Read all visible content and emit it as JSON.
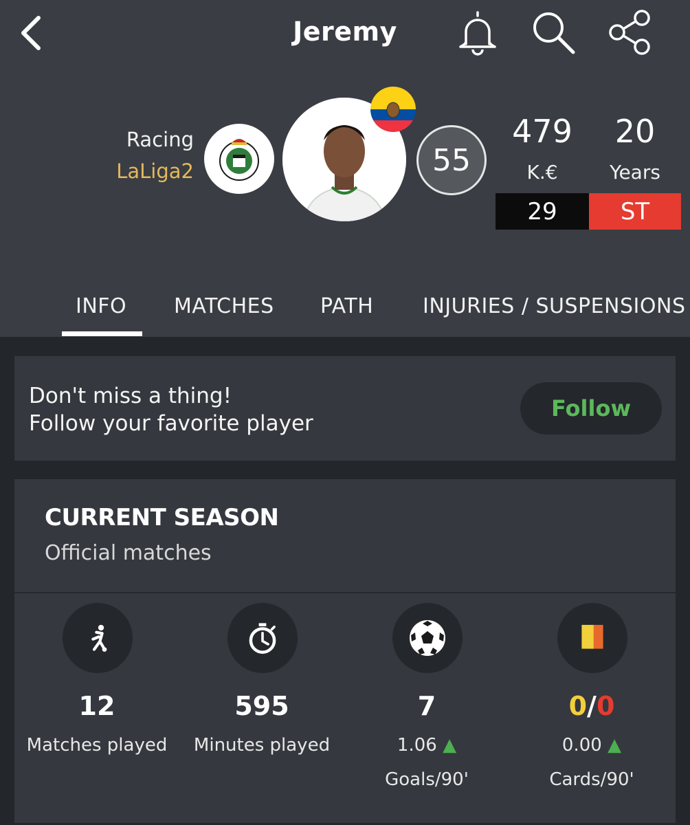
{
  "header": {
    "title": "Jeremy",
    "team": "Racing",
    "league": "LaLiga2",
    "rating": "55",
    "value": "479",
    "value_unit": "K.€",
    "age": "20",
    "age_unit": "Years",
    "shirt_number": "29",
    "position": "ST"
  },
  "tabs": [
    {
      "label": "INFO",
      "active": true
    },
    {
      "label": "MATCHES",
      "active": false
    },
    {
      "label": "PATH",
      "active": false
    },
    {
      "label": "INJURIES / SUSPENSIONS",
      "active": false
    }
  ],
  "follow": {
    "line1": "Don't miss a thing!",
    "line2": "Follow your favorite player",
    "button": "Follow"
  },
  "season": {
    "title": "CURRENT SEASON",
    "subtitle": "Official matches",
    "stats": {
      "matches": {
        "value": "12",
        "label": "Matches played",
        "icon": "player-running-icon"
      },
      "minutes": {
        "value": "595",
        "label": "Minutes played",
        "icon": "stopwatch-icon"
      },
      "goals": {
        "value": "7",
        "ratio": "1.06",
        "label": "Goals/90'",
        "icon": "soccer-ball-icon"
      },
      "cards": {
        "yellow": "0",
        "sep": "/",
        "red": "0",
        "ratio": "0.00",
        "label": "Cards/90'",
        "icon": "yellow-red-cards-icon"
      }
    }
  },
  "colors": {
    "header_bg": "#3a3d43",
    "page_bg": "#23262b",
    "card_bg": "#35383e",
    "league": "#e4b95b",
    "position_bg": "#e53b30",
    "follow_text": "#5cb85c",
    "trend_up": "#4caf50"
  }
}
